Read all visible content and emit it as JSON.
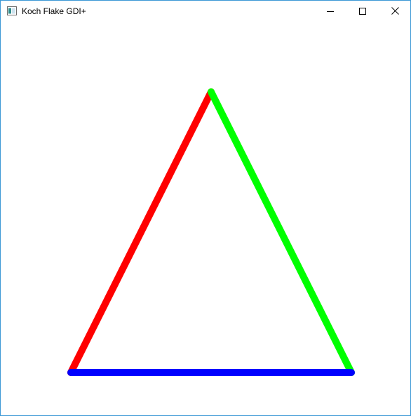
{
  "window": {
    "title": "Koch Flake GDI+"
  },
  "icons": {
    "app": "app-window-icon",
    "minimize": "minimize-icon",
    "maximize": "maximize-icon",
    "close": "close-icon"
  },
  "colors": {
    "window_border": "#3c98d6",
    "left_edge": "#ff0000",
    "right_edge": "#00ff00",
    "bottom_edge": "#0000ff"
  }
}
